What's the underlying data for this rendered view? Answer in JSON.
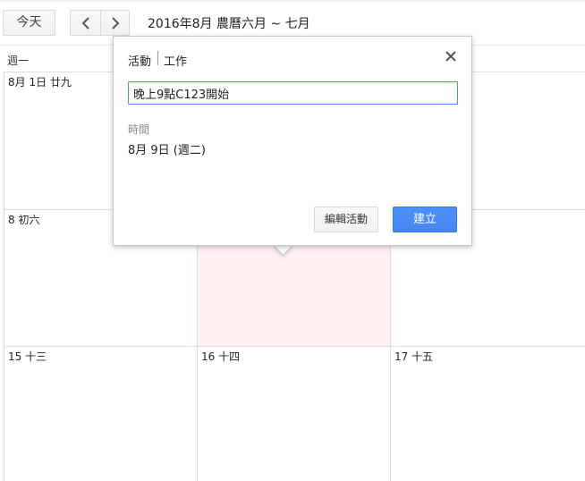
{
  "toolbar": {
    "today_label": "今天",
    "prev_icon": "chevron-left-icon",
    "next_icon": "chevron-right-icon",
    "date_range": "2016年8月 農曆六月 ~ 七月"
  },
  "calendar": {
    "day_of_week": "週一",
    "cells": {
      "r1c1": "8月 1日 廿九",
      "r2c1": "8 初六",
      "r3c1": "15 十三",
      "r3c2": "16 十四",
      "r3c3": "17 十五"
    },
    "today_highlight_color": "#fff1f1"
  },
  "popup": {
    "tab_event": "活動",
    "tab_task": "工作",
    "close_icon": "close-icon",
    "title_value": "晚上9點C123開始",
    "time_label": "時間",
    "time_value": "8月 9日 (週二)",
    "edit_label": "編輯活動",
    "create_label": "建立",
    "accent_color": "#4d90fe"
  }
}
